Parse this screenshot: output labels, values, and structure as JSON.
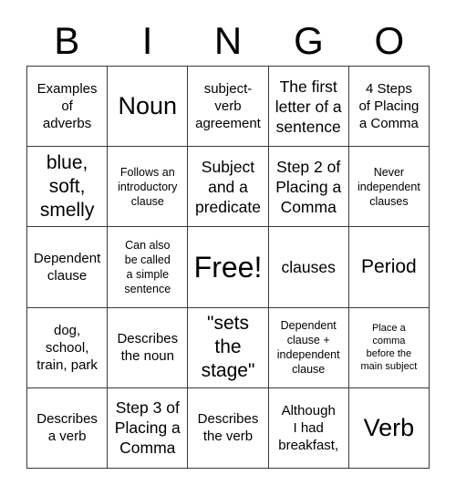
{
  "header": {
    "letters": [
      "B",
      "I",
      "N",
      "G",
      "O"
    ]
  },
  "grid": {
    "rows": 5,
    "columns": 5,
    "border_color": "#3a3a3a",
    "background_color": "#ffffff",
    "text_color": "#000000",
    "free_space": {
      "row": 3,
      "column": 3,
      "label": "Free!"
    },
    "cells": [
      {
        "text": "Examples\nof\nadverbs",
        "size": "m"
      },
      {
        "text": "Noun",
        "size": "xxl"
      },
      {
        "text": "subject-\nverb\nagreement",
        "size": "m"
      },
      {
        "text": "The first\nletter of a\nsentence",
        "size": "l"
      },
      {
        "text": "4 Steps\nof Placing\na Comma",
        "size": "m"
      },
      {
        "text": "blue,\nsoft,\nsmelly",
        "size": "xl"
      },
      {
        "text": "Follows an\nintroductory\nclause",
        "size": "s"
      },
      {
        "text": "Subject\nand a\npredicate",
        "size": "l"
      },
      {
        "text": "Step 2 of\nPlacing a\nComma",
        "size": "l"
      },
      {
        "text": "Never\nindependent\nclauses",
        "size": "s"
      },
      {
        "text": "Dependent\nclause",
        "size": "m"
      },
      {
        "text": "Can also\nbe called\na simple\nsentence",
        "size": "s"
      },
      {
        "text": "Free!",
        "size": "huge"
      },
      {
        "text": "clauses",
        "size": "l"
      },
      {
        "text": "Period",
        "size": "xl"
      },
      {
        "text": "dog,\nschool,\ntrain, park",
        "size": "m"
      },
      {
        "text": "Describes\nthe noun",
        "size": "m"
      },
      {
        "text": "\"sets\nthe\nstage\"",
        "size": "xl"
      },
      {
        "text": "Dependent\nclause +\nindependent\nclause",
        "size": "s"
      },
      {
        "text": "Place a\ncomma\nbefore the\nmain subject",
        "size": "xs"
      },
      {
        "text": "Describes\na verb",
        "size": "m"
      },
      {
        "text": "Step 3 of\nPlacing a\nComma",
        "size": "l"
      },
      {
        "text": "Describes\nthe verb",
        "size": "m"
      },
      {
        "text": "Although\nI had\nbreakfast,",
        "size": "m"
      },
      {
        "text": "Verb",
        "size": "xxl"
      }
    ]
  }
}
